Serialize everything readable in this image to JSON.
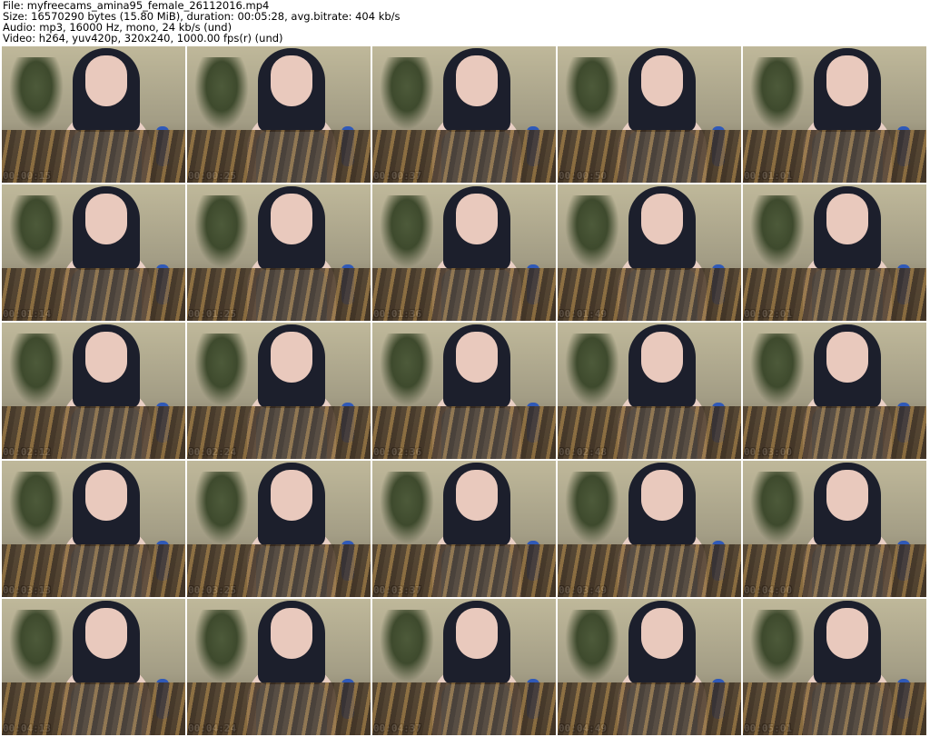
{
  "header": {
    "file": "File: myfreecams_amina95_female_26112016.mp4",
    "size": "Size: 16570290 bytes (15.80 MiB), duration: 00:05:28, avg.bitrate: 404 kb/s",
    "audio": "Audio: mp3, 16000 Hz, mono, 24 kb/s (und)",
    "video": "Video: h264, yuv420p, 320x240, 1000.00 fps(r) (und)"
  },
  "thumbnails": [
    {
      "timestamp": "00:00:15"
    },
    {
      "timestamp": "00:00:25"
    },
    {
      "timestamp": "00:00:37"
    },
    {
      "timestamp": "00:00:50"
    },
    {
      "timestamp": "00:01:01"
    },
    {
      "timestamp": "00:01:14"
    },
    {
      "timestamp": "00:01:25"
    },
    {
      "timestamp": "00:01:36"
    },
    {
      "timestamp": "00:01:49"
    },
    {
      "timestamp": "00:02:01"
    },
    {
      "timestamp": "00:02:12"
    },
    {
      "timestamp": "00:02:24"
    },
    {
      "timestamp": "00:02:36"
    },
    {
      "timestamp": "00:02:48"
    },
    {
      "timestamp": "00:03:00"
    },
    {
      "timestamp": "00:03:13"
    },
    {
      "timestamp": "00:03:25"
    },
    {
      "timestamp": "00:03:37"
    },
    {
      "timestamp": "00:03:49"
    },
    {
      "timestamp": "00:04:00"
    },
    {
      "timestamp": "00:04:13"
    },
    {
      "timestamp": "00:04:24"
    },
    {
      "timestamp": "00:04:37"
    },
    {
      "timestamp": "00:04:49"
    },
    {
      "timestamp": "00:05:01"
    }
  ]
}
